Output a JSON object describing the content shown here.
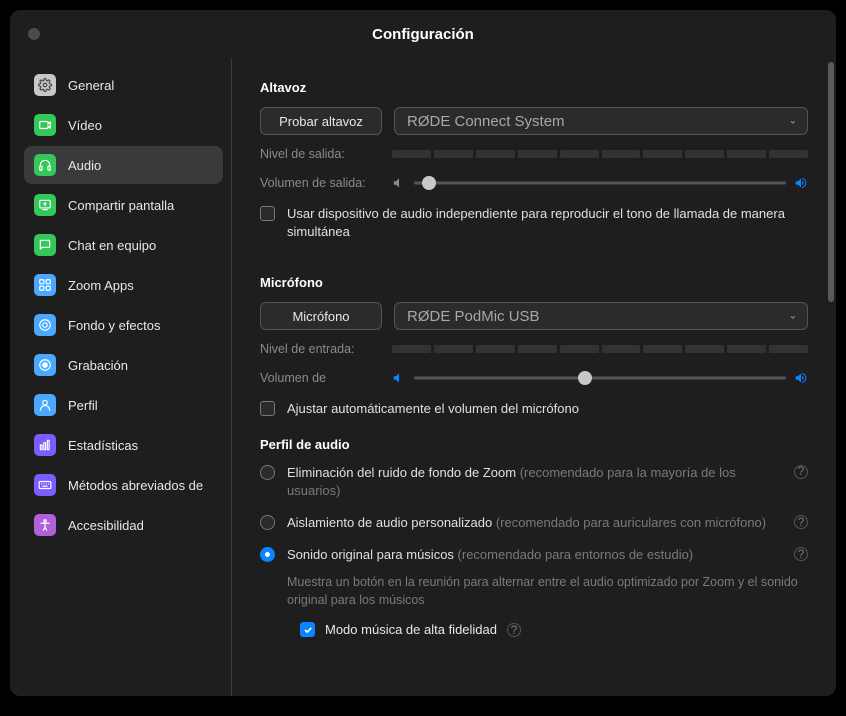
{
  "window": {
    "title": "Configuración"
  },
  "sidebar": {
    "items": [
      {
        "label": "General",
        "icon": "gear",
        "bg": "#c8c8c8",
        "fg": "#444"
      },
      {
        "label": "Vídeo",
        "icon": "video",
        "bg": "#34c759"
      },
      {
        "label": "Audio",
        "icon": "headphones",
        "bg": "#34c759",
        "selected": true
      },
      {
        "label": "Compartir pantalla",
        "icon": "share",
        "bg": "#34c759"
      },
      {
        "label": "Chat en equipo",
        "icon": "chat",
        "bg": "#34c759"
      },
      {
        "label": "Zoom Apps",
        "icon": "apps",
        "bg": "#4aa8ff"
      },
      {
        "label": "Fondo y efectos",
        "icon": "effects",
        "bg": "#4aa8ff"
      },
      {
        "label": "Grabación",
        "icon": "record",
        "bg": "#4aa8ff"
      },
      {
        "label": "Perfil",
        "icon": "profile",
        "bg": "#4aa8ff"
      },
      {
        "label": "Estadísticas",
        "icon": "stats",
        "bg": "#7a5cff"
      },
      {
        "label": "Métodos abreviados de",
        "icon": "keyboard",
        "bg": "#7a5cff"
      },
      {
        "label": "Accesibilidad",
        "icon": "accessibility",
        "bg": "#b060d8"
      }
    ]
  },
  "speaker": {
    "section_title": "Altavoz",
    "test_button": "Probar altavoz",
    "device": "RØDE Connect System",
    "output_level_label": "Nivel de salida:",
    "output_volume_label": "Volumen de salida:",
    "output_volume_pct": 4,
    "independent_ringtone_label": "Usar dispositivo de audio independiente para reproducir el tono de llamada de manera simultánea",
    "independent_ringtone_checked": false
  },
  "microphone": {
    "section_title": "Micrófono",
    "test_button": "Micrófono",
    "device": "RØDE PodMic USB",
    "input_level_label": "Nivel de entrada:",
    "input_volume_label": "Volumen de",
    "input_volume_pct": 46,
    "auto_adjust_label": "Ajustar automáticamente el volumen del micrófono",
    "auto_adjust_checked": false
  },
  "audio_profile": {
    "section_title": "Perfil de audio",
    "options": [
      {
        "label": "Eliminación del ruido de fondo de Zoom ",
        "hint": "(recomendado para la mayoría de los usuarios)",
        "checked": false
      },
      {
        "label": "Aislamiento de audio personalizado ",
        "hint": "(recomendado para auriculares con micrófono)",
        "checked": false
      },
      {
        "label": "Sonido original para músicos ",
        "hint": "(recomendado para entornos de estudio)",
        "checked": true,
        "description": "Muestra un botón en la reunión para alternar entre el audio optimizado por Zoom y el sonido original para los músicos",
        "sub_option": {
          "label": "Modo música de alta fidelidad",
          "checked": true
        }
      }
    ]
  }
}
